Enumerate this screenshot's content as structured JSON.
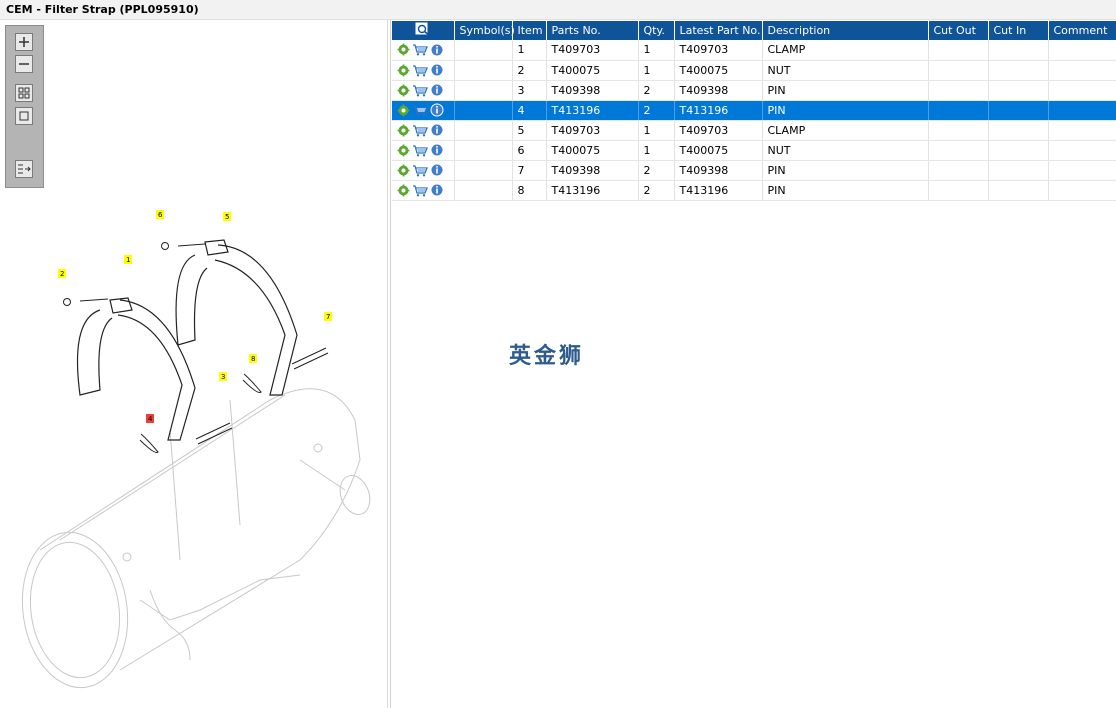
{
  "window": {
    "title": "CEM - Filter Strap (PPL095910)"
  },
  "toolbar": {
    "buttons": [
      {
        "icon": "zoom-in-icon"
      },
      {
        "icon": "zoom-out-icon"
      },
      {
        "icon": "fit-grid-icon"
      },
      {
        "icon": "actual-size-icon"
      },
      {
        "icon": "export-list-icon"
      }
    ]
  },
  "diagram": {
    "callouts": [
      "1",
      "2",
      "3",
      "4",
      "5",
      "6",
      "7",
      "8"
    ],
    "highlighted_callout": "4",
    "highlight_color": "#e8413c",
    "callout_color": "#ffff00"
  },
  "table": {
    "header_icon": "search-parts-icon",
    "columns": [
      "Symbol(s)",
      "Item",
      "Parts No.",
      "Qty.",
      "Latest Part No.",
      "Description",
      "Cut Out",
      "Cut In",
      "Comment"
    ],
    "rows": [
      {
        "item": "1",
        "part_no": "T409703",
        "qty": "1",
        "latest": "T409703",
        "desc": "CLAMP",
        "selected": false
      },
      {
        "item": "2",
        "part_no": "T400075",
        "qty": "1",
        "latest": "T400075",
        "desc": "NUT",
        "selected": false
      },
      {
        "item": "3",
        "part_no": "T409398",
        "qty": "2",
        "latest": "T409398",
        "desc": "PIN",
        "selected": false
      },
      {
        "item": "4",
        "part_no": "T413196",
        "qty": "2",
        "latest": "T413196",
        "desc": "PIN",
        "selected": true
      },
      {
        "item": "5",
        "part_no": "T409703",
        "qty": "1",
        "latest": "T409703",
        "desc": "CLAMP",
        "selected": false
      },
      {
        "item": "6",
        "part_no": "T400075",
        "qty": "1",
        "latest": "T400075",
        "desc": "NUT",
        "selected": false
      },
      {
        "item": "7",
        "part_no": "T409398",
        "qty": "2",
        "latest": "T409398",
        "desc": "PIN",
        "selected": false
      },
      {
        "item": "8",
        "part_no": "T413196",
        "qty": "2",
        "latest": "T413196",
        "desc": "PIN",
        "selected": false
      }
    ],
    "row_icons": [
      "gear-icon",
      "cart-icon",
      "info-icon"
    ]
  },
  "watermark": {
    "text": "英金狮"
  },
  "colors": {
    "header_bg": "#0f5498",
    "selected_row": "#0078d7",
    "gear": "#5aa832",
    "cart": "#2d72c4",
    "info": "#3f7ecc"
  }
}
